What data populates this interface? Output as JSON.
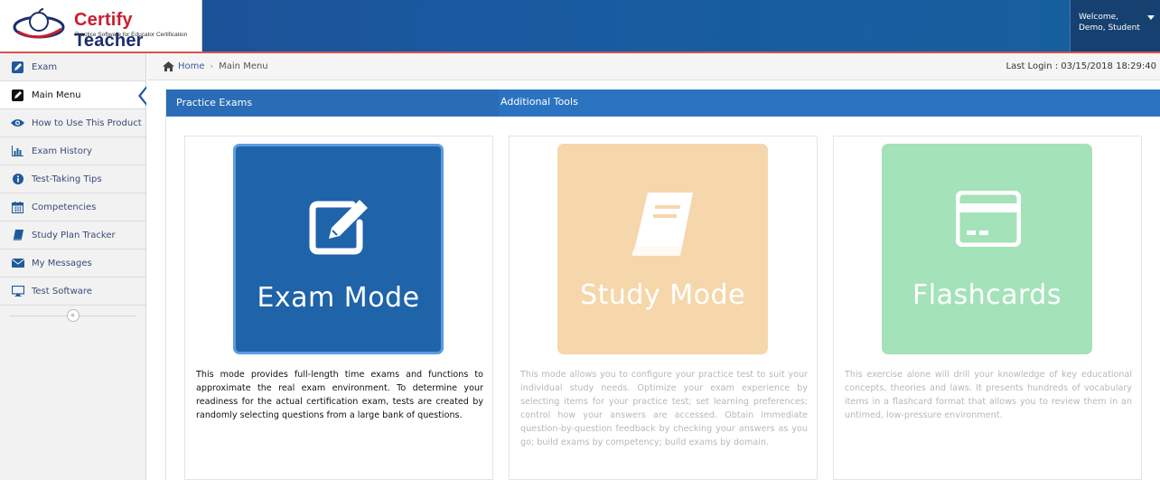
{
  "header": {
    "logo_title_part1": "Certify",
    "logo_title_part2": "Teacher",
    "logo_subtitle": "Practice Software for Educator Certification",
    "welcome_line1": "Welcome,",
    "welcome_line2": "Demo, Student"
  },
  "sidebar": {
    "items": [
      {
        "label": "Exam",
        "icon": "edit-icon"
      },
      {
        "label": "Main Menu",
        "icon": "edit-icon"
      },
      {
        "label": "How to Use This Product",
        "icon": "eye-icon"
      },
      {
        "label": "Exam History",
        "icon": "bar-chart-icon"
      },
      {
        "label": "Test-Taking Tips",
        "icon": "info-icon"
      },
      {
        "label": "Competencies",
        "icon": "calendar-icon"
      },
      {
        "label": "Study Plan Tracker",
        "icon": "book-icon"
      },
      {
        "label": "My Messages",
        "icon": "envelope-icon"
      },
      {
        "label": "Test Software",
        "icon": "monitor-icon"
      }
    ],
    "collapse_symbol": "«"
  },
  "topbar": {
    "breadcrumb_home": "Home",
    "breadcrumb_separator": "›",
    "breadcrumb_current": "Main Menu",
    "last_login": "Last Login : 03/15/2018 18:29:40"
  },
  "panel": {
    "tab_practice": "Practice Exams",
    "tab_tools": "Additional Tools"
  },
  "cards": [
    {
      "title": "Exam Mode",
      "icon": "edit-icon",
      "description": "This mode provides full-length time exams and functions to approximate the real exam environment. To determine your readiness for the actual certification exam, tests are created by randomly selecting questions from a large bank of questions."
    },
    {
      "title": "Study Mode",
      "icon": "book-icon",
      "description": "This mode allows you to configure your practice test to suit your individual study needs. Optimize your exam experience by selecting items for your practice test; set learning preferences; control how your answers are accessed. Obtain immediate question-by-question feedback by checking your answers as you go; build exams by competency; build exams by domain."
    },
    {
      "title": "Flashcards",
      "icon": "card-icon",
      "description": "This exercise alone will drill your knowledge of key educational concepts, theories and laws. It presents hundreds of vocabulary items in a flashcard format that allows you to review them in an untimed, low-pressure environment."
    }
  ],
  "colors": {
    "header_blue": "#1e4a92",
    "exam_tile": "#1f63a8",
    "study_tile": "#f5d7ab",
    "flash_tile": "#a4e2b9",
    "accent_red": "#d9534f"
  }
}
